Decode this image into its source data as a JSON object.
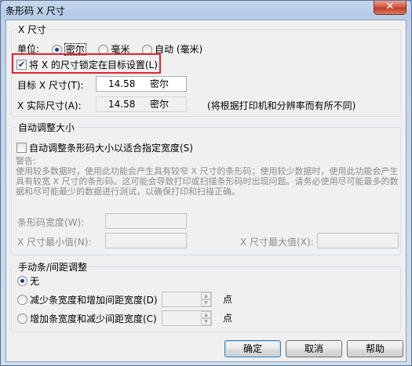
{
  "window": {
    "title": "条形码 X 尺寸",
    "close_glyph": "✕"
  },
  "x_size": {
    "legend": "X 尺寸",
    "unit_label": "单位:",
    "units": [
      {
        "label": "密尔",
        "selected": true
      },
      {
        "label": "毫米",
        "selected": false
      },
      {
        "label": "自动 (毫米)",
        "selected": false
      }
    ],
    "lock_checkbox": {
      "label": "将 X 的尺寸锁定在目标设置(L)",
      "checked": true
    },
    "target_label": "目标 X 尺寸(T):",
    "target_value": "14.58",
    "target_unit": "密尔",
    "actual_label": "X 实际尺寸(A):",
    "actual_value": "14.58",
    "actual_unit": "密尔",
    "note": "(将根据打印机和分辨率而有所不同)"
  },
  "auto_adjust": {
    "legend": "自动调整大小",
    "checkbox": {
      "label": "自动调整条形码大小以适合指定宽度(S)",
      "checked": false
    },
    "warning_title": "警告:",
    "warning_text": "使用较多数据时，使用此功能会产生具有较窄 X 尺寸的条形码；使用较少数据时，使用此功能会产生具有较宽 X 尺寸的条形码。这可能会导致打印或扫描条形码时出现问题。请务必使用尽可能最多的数据和尽可能最少的数据进行测试，以确保打印和扫描正确。",
    "width_label": "条形码宽度(W):",
    "min_label": "X 尺寸最小值(N):",
    "max_label": "X 尺寸最大值(X):"
  },
  "manual": {
    "legend": "手动条/间距调整",
    "options": [
      {
        "label": "无",
        "selected": true
      },
      {
        "label": "减少条宽度和增加间距宽度(D)",
        "selected": false,
        "unit": "点"
      },
      {
        "label": "增加条宽度和减少间距宽度(C)",
        "selected": false,
        "unit": "点"
      }
    ]
  },
  "buttons": {
    "ok": "确定",
    "cancel": "取消",
    "help": "帮助"
  },
  "colors": {
    "highlight": "#e0242a",
    "accent": "#1b3f8c"
  }
}
